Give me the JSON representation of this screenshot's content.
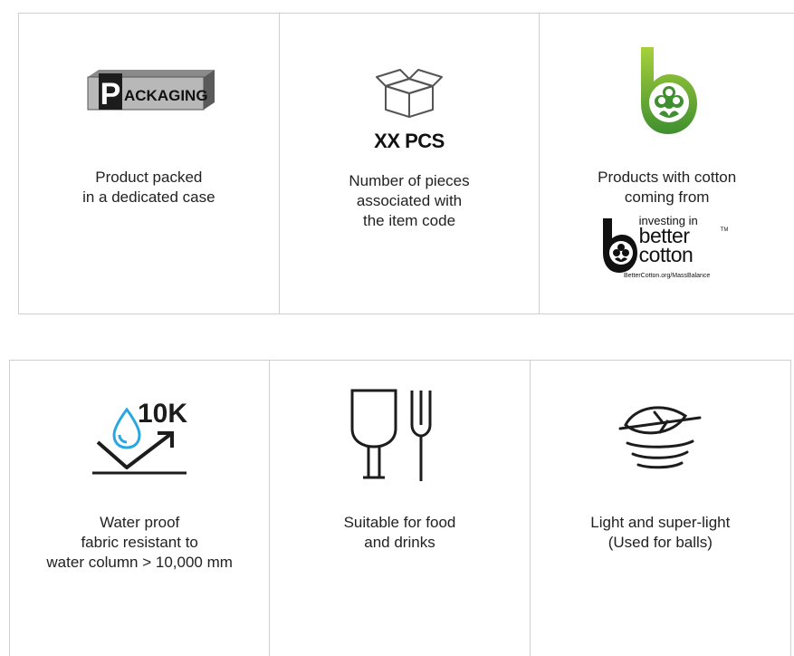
{
  "top_row": [
    {
      "icon": "packaging-box-icon",
      "icon_text": "ACKAGING",
      "icon_initial": "P",
      "lines": [
        "Product packed",
        "in a dedicated case"
      ]
    },
    {
      "icon": "open-box-icon",
      "label": "XX PCS",
      "lines": [
        "Number of pieces",
        "associated with",
        "the item code"
      ]
    },
    {
      "icon": "better-cotton-b-icon",
      "lines": [
        "Products with cotton",
        "coming from"
      ],
      "badge": {
        "line1": "investing in",
        "line2": "better",
        "line3": "cotton",
        "tm": "TM",
        "url": "BetterCotton.org/MassBalance"
      }
    }
  ],
  "bottom_row": [
    {
      "icon": "waterproof-10k-icon",
      "icon_text": "10K",
      "lines": [
        "Water proof",
        "fabric resistant to",
        "water column > 10,000 mm"
      ]
    },
    {
      "icon": "food-safe-glass-fork-icon",
      "lines": [
        "Suitable for food",
        "and drinks"
      ]
    },
    {
      "icon": "lightweight-leaf-icon",
      "lines": [
        "Light and super-light",
        "(Used for balls)"
      ]
    }
  ],
  "colors": {
    "border": "#cfcfcf",
    "cotton_green_light": "#9ccc3c",
    "cotton_green_dark": "#3f8f2f",
    "text": "#222222"
  }
}
